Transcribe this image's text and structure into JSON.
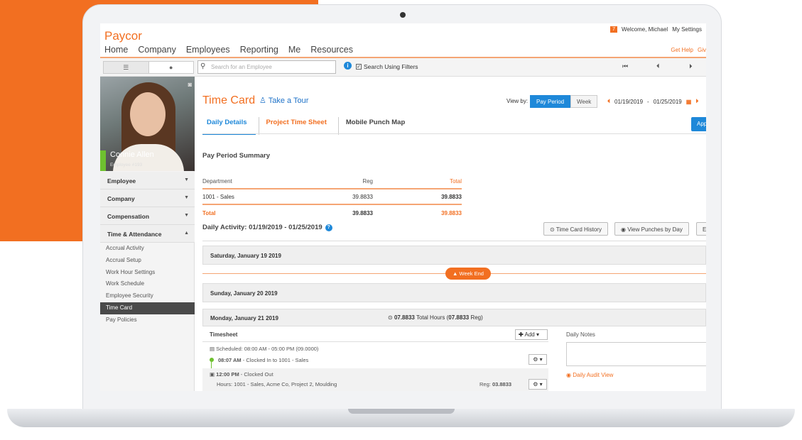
{
  "app": {
    "logo": "Paycor",
    "nav": [
      "Home",
      "Company",
      "Employees",
      "Reporting",
      "Me",
      "Resources"
    ],
    "badge_count": "7",
    "welcome": "Welcome, Michael",
    "my_settings": "My Settings",
    "get_help": "Get Help",
    "give": "Giv"
  },
  "toolbar": {
    "search_placeholder": "Search for an Employee",
    "search_filters_label": "Search Using Filters"
  },
  "employee": {
    "name": "Connie Allen",
    "id": "Employee #193"
  },
  "sidebar": {
    "sections": [
      {
        "label": "Employee",
        "caret": "▼"
      },
      {
        "label": "Company",
        "caret": "▼"
      },
      {
        "label": "Compensation",
        "caret": "▼"
      },
      {
        "label": "Time & Attendance",
        "caret": "▲"
      }
    ],
    "items": [
      "Accrual Activity",
      "Accrual Setup",
      "Work Hour Settings",
      "Work Schedule",
      "Employee Security",
      "Time Card",
      "Pay Policies"
    ],
    "active_item": "Time Card"
  },
  "timecard": {
    "title": "Time Card",
    "tour": "Take a Tour",
    "view_by": "View by:",
    "view_pay_period": "Pay Period",
    "view_week": "Week",
    "range_start": "01/19/2019",
    "range_sep": "-",
    "range_end": "01/25/2019",
    "approve": "Appr",
    "tabs": [
      "Daily Details",
      "Project Time Sheet",
      "Mobile Punch Map"
    ]
  },
  "summary": {
    "title": "Pay Period Summary",
    "headers": [
      "Department",
      "Reg",
      "Total"
    ],
    "rows": [
      [
        "1001 - Sales",
        "39.8833",
        "39.8833"
      ]
    ],
    "total": [
      "Total",
      "39.8833",
      "39.8833"
    ]
  },
  "daily": {
    "title": "Daily Activity: 01/19/2019 - 01/25/2019",
    "history_btn": "Time Card History",
    "punches_btn": "View Punches by Day",
    "extra_btn": "E",
    "sat": "Saturday, January 19 2019",
    "week_end": "Week End",
    "sun": "Sunday, January 20 2019",
    "mon": "Monday, January 21 2019",
    "mon_hours_value": "07.8833",
    "mon_hours_text": "Total Hours (",
    "mon_reg_value": "07.8833",
    "mon_reg_text": "Reg)",
    "timesheet": "Timesheet",
    "add": "Add",
    "scheduled": "Scheduled: 08:00 AM - 05:00 PM (09.0000)",
    "in_time": "08:07 AM",
    "in_text": "- Clocked In to 1001 - Sales",
    "out_time": "12:00 PM",
    "out_text": "- Clocked Out",
    "hours_line": "Hours: 1001 - Sales, Acme Co, Project 2, Moulding",
    "reg_label": "Reg:",
    "reg_value": "03.8833",
    "daily_notes": "Daily Notes",
    "audit": "Daily Audit View"
  }
}
